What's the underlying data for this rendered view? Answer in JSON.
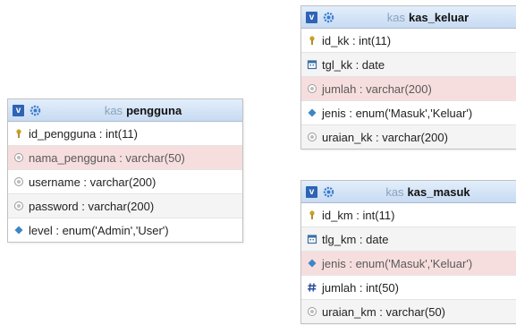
{
  "tables": {
    "pengguna": {
      "v": "v",
      "db": "kas",
      "name": "pengguna",
      "rows": [
        "id_pengguna : int(11)",
        "nama_pengguna : varchar(50)",
        "username : varchar(200)",
        "password : varchar(200)",
        "level : enum('Admin','User')"
      ]
    },
    "kas_keluar": {
      "v": "v",
      "db": "kas",
      "name": "kas_keluar",
      "rows": [
        "id_kk : int(11)",
        "tgl_kk : date",
        "jumlah : varchar(200)",
        "jenis : enum('Masuk','Keluar')",
        "uraian_kk : varchar(200)"
      ]
    },
    "kas_masuk": {
      "v": "v",
      "db": "kas",
      "name": "kas_masuk",
      "rows": [
        "id_km : int(11)",
        "tlg_km : date",
        "jenis : enum('Masuk','Keluar')",
        "jumlah : int(50)",
        "uraian_km : varchar(50)"
      ]
    }
  },
  "colors": {
    "header": "#c8dbf2",
    "highlight_row": "#f7dede",
    "key_icon": "#c9a227",
    "date_icon": "#3b6ea5",
    "enum_icon": "#3c86c7",
    "int_icon": "#2e4f9c",
    "text_icon": "#9a9a9a"
  },
  "icons": [
    "primary-key-icon",
    "text-column-icon",
    "date-column-icon",
    "enum-column-icon",
    "numeric-column-icon",
    "gear-icon"
  ]
}
